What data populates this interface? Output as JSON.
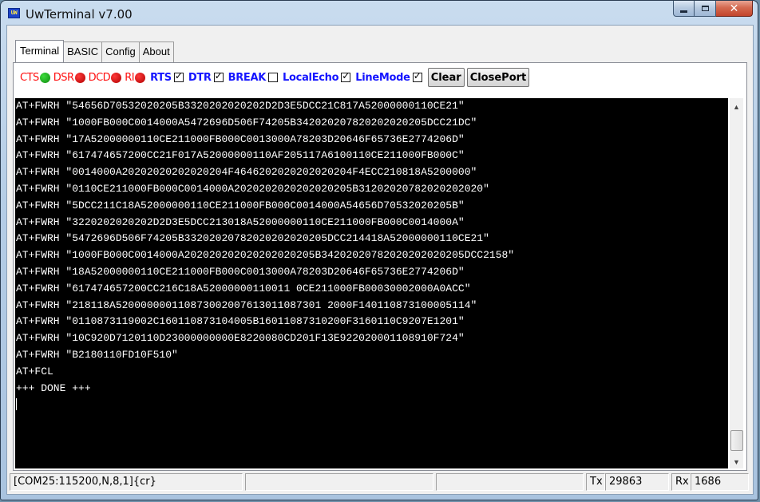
{
  "window": {
    "title": "UwTerminal v7.00",
    "icon_label": "UW",
    "minimize": "minimize-icon",
    "maximize": "maximize-icon",
    "close_glyph": "✕"
  },
  "tabs": [
    {
      "label": "Terminal",
      "active": true
    },
    {
      "label": "BASIC",
      "active": false
    },
    {
      "label": "Config",
      "active": false
    },
    {
      "label": "About",
      "active": false
    }
  ],
  "indicators": [
    {
      "label": "CTS",
      "state": "green"
    },
    {
      "label": "DSR",
      "state": "red"
    },
    {
      "label": "DCD",
      "state": "red"
    },
    {
      "label": "RI",
      "state": "red"
    }
  ],
  "checkboxes": [
    {
      "label": "RTS",
      "checked": true
    },
    {
      "label": "DTR",
      "checked": true
    },
    {
      "label": "BREAK",
      "checked": false
    },
    {
      "label": "LocalEcho",
      "checked": true
    },
    {
      "label": "LineMode",
      "checked": true
    }
  ],
  "buttons": {
    "clear": "Clear",
    "close_port": "ClosePort"
  },
  "terminal_lines": [
    "AT+FWRH \"54656D70532020205B3320202020202D2D3E5DCC21C817A52000000110CE21\"",
    "AT+FWRH \"1000FB000C0014000A5472696D506F74205B342020207820202020205DCC21DC\"",
    "AT+FWRH \"17A52000000110CE211000FB000C0013000A78203D20646F65736E2774206D\"",
    "AT+FWRH \"617474657200CC21F017A52000000110AF205117A6100110CE211000FB000C\"",
    "AT+FWRH \"0014000A20202020202020204F4646202020202020204F4ECC210818A5200000\"",
    "AT+FWRH \"0110CE211000FB000C0014000A2020202020202020205B31202020782020202020\"",
    "AT+FWRH \"5DCC211C18A52000000110CE211000FB000C0014000A54656D70532020205B\"",
    "AT+FWRH \"3220202020202D2D3E5DCC213018A52000000110CE211000FB000C0014000A\"",
    "AT+FWRH \"5472696D506F74205B33202020782020202020205DCC214418A52000000110CE21\"",
    "AT+FWRH \"1000FB000C0014000A202020202020202020205B34202020782020202020205DCC2158\"",
    "AT+FWRH \"18A52000000110CE211000FB000C0013000A78203D20646F65736E2774206D\"",
    "AT+FWRH \"617474657200CC216C18A52000000110011 0CE211000FB00030002000A0ACC\"",
    "AT+FWRH \"218118A520000000110873002007613011087301 2000F140110873100005114\"",
    "AT+FWRH \"0110873119002C160110873104005B16011087310200F3160110C9207E1201\"",
    "AT+FWRH \"10C920D7120110D23000000000E8220080CD201F13E922020001108910F724\"",
    "AT+FWRH \"B2180110FD10F510\"",
    "AT+FCL",
    "+++ DONE +++"
  ],
  "scroll_up": "▲",
  "scroll_down": "▼",
  "status": {
    "port": "[COM25:115200,N,8,1]{cr}",
    "tx_label": "Tx",
    "tx_value": "29863",
    "rx_label": "Rx",
    "rx_value": "1686"
  }
}
